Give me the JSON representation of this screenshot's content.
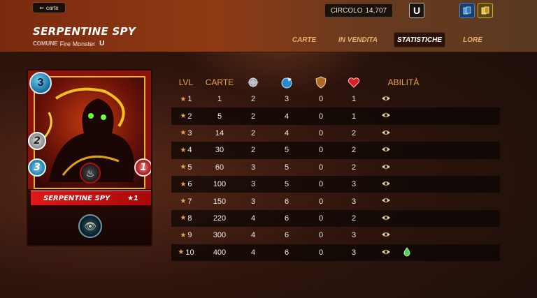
{
  "header": {
    "back_label": "carte",
    "card_name": "SERPENTINE SPY",
    "rarity": "COMUNE",
    "element_type": "Fire Monster",
    "edition_mark": "U",
    "circolo_label": "CIRCOLO",
    "circolo_value": "14,707",
    "league_mark": "U"
  },
  "tabs": [
    {
      "label": "CARTE",
      "active": false
    },
    {
      "label": "IN VENDITA",
      "active": false
    },
    {
      "label": "STATISTICHE",
      "active": true
    },
    {
      "label": "LORE",
      "active": false
    }
  ],
  "card": {
    "mana": "3",
    "melee": "2",
    "speed": "3",
    "health": "1",
    "name": "SERPENTINE SPY",
    "level_label": "★1",
    "ability_icon": "sneak-icon",
    "colors": {
      "frame": "#8a1208",
      "name_bar": "#e01818",
      "accent": "#e8b030"
    }
  },
  "table": {
    "headers": {
      "lvl": "LVL",
      "carte": "CARTE",
      "melee_icon": "melee-attack-icon",
      "speed_icon": "speed-icon",
      "armor_icon": "armor-icon",
      "health_icon": "health-icon",
      "abilita": "ABILITÀ"
    },
    "rows": [
      {
        "lvl": "1",
        "carte": "1",
        "melee": "2",
        "speed": "3",
        "armor": "0",
        "health": "1",
        "abilities": [
          "sneak"
        ]
      },
      {
        "lvl": "2",
        "carte": "5",
        "melee": "2",
        "speed": "4",
        "armor": "0",
        "health": "1",
        "abilities": [
          "sneak"
        ]
      },
      {
        "lvl": "3",
        "carte": "14",
        "melee": "2",
        "speed": "4",
        "armor": "0",
        "health": "2",
        "abilities": [
          "sneak"
        ]
      },
      {
        "lvl": "4",
        "carte": "30",
        "melee": "2",
        "speed": "5",
        "armor": "0",
        "health": "2",
        "abilities": [
          "sneak"
        ]
      },
      {
        "lvl": "5",
        "carte": "60",
        "melee": "3",
        "speed": "5",
        "armor": "0",
        "health": "2",
        "abilities": [
          "sneak"
        ]
      },
      {
        "lvl": "6",
        "carte": "100",
        "melee": "3",
        "speed": "5",
        "armor": "0",
        "health": "3",
        "abilities": [
          "sneak"
        ]
      },
      {
        "lvl": "7",
        "carte": "150",
        "melee": "3",
        "speed": "6",
        "armor": "0",
        "health": "3",
        "abilities": [
          "sneak"
        ]
      },
      {
        "lvl": "8",
        "carte": "220",
        "melee": "4",
        "speed": "6",
        "armor": "0",
        "health": "2",
        "abilities": [
          "sneak"
        ]
      },
      {
        "lvl": "9",
        "carte": "300",
        "melee": "4",
        "speed": "6",
        "armor": "0",
        "health": "3",
        "abilities": [
          "sneak"
        ]
      },
      {
        "lvl": "10",
        "carte": "400",
        "melee": "4",
        "speed": "6",
        "armor": "0",
        "health": "3",
        "abilities": [
          "sneak",
          "poison"
        ]
      }
    ]
  },
  "colors": {
    "header_accent": "#e8a44a",
    "active_tab_bg": "#2b120a",
    "tab_text": "#e8b070"
  }
}
